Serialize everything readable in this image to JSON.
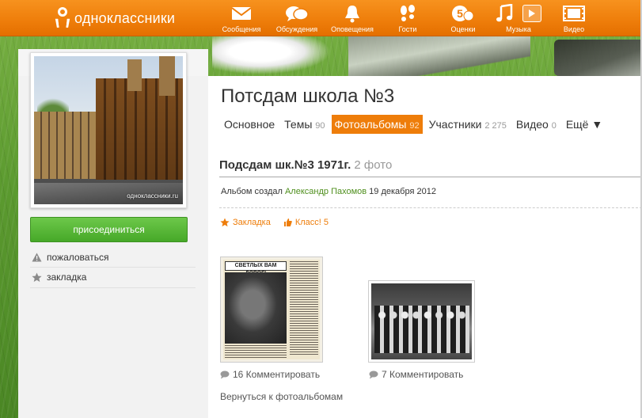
{
  "brand": {
    "name": "одноклассники",
    "accent": "#ee7d0a",
    "green": "#4f8f1d"
  },
  "nav": [
    {
      "label": "Сообщения",
      "icon": "envelope-icon"
    },
    {
      "label": "Обсуждения",
      "icon": "speech-bubbles-icon"
    },
    {
      "label": "Оповещения",
      "icon": "bell-icon"
    },
    {
      "label": "Гости",
      "icon": "footprints-icon"
    },
    {
      "label": "Оценки",
      "icon": "rating-5-icon"
    },
    {
      "label": "Музыка",
      "icon": "music-note-icon"
    },
    {
      "label": "Видео",
      "icon": "film-icon"
    }
  ],
  "sidebar": {
    "avatar_watermark": "одноклассники.ru",
    "join_label": "присоединиться",
    "report_label": "пожаловаться",
    "bookmark_label": "закладка"
  },
  "group": {
    "title": "Потсдам школа №3",
    "tabs": [
      {
        "label": "Основное",
        "count": ""
      },
      {
        "label": "Темы",
        "count": "90"
      },
      {
        "label": "Фотоальбомы",
        "count": "92",
        "active": true
      },
      {
        "label": "Участники",
        "count": "2 275"
      },
      {
        "label": "Видео",
        "count": "0"
      },
      {
        "label": "Ещё ▼",
        "count": ""
      }
    ]
  },
  "album": {
    "title": "Подсдам шк.№3 1971г.",
    "photo_count": "2 фото",
    "author_prefix": "Альбом создал",
    "author_name": "Александр Пахомов",
    "date": "19 декабря 2012",
    "bookmark_label": "Закладка",
    "klass_label": "Класс! 5",
    "newspaper_header": "СВЕТЛЫХ ВАМ ДОРОГ!",
    "photos": [
      {
        "comments": "16 Комментировать"
      },
      {
        "comments": "7 Комментировать"
      }
    ],
    "back_label": "Вернуться к фотоальбомам"
  }
}
